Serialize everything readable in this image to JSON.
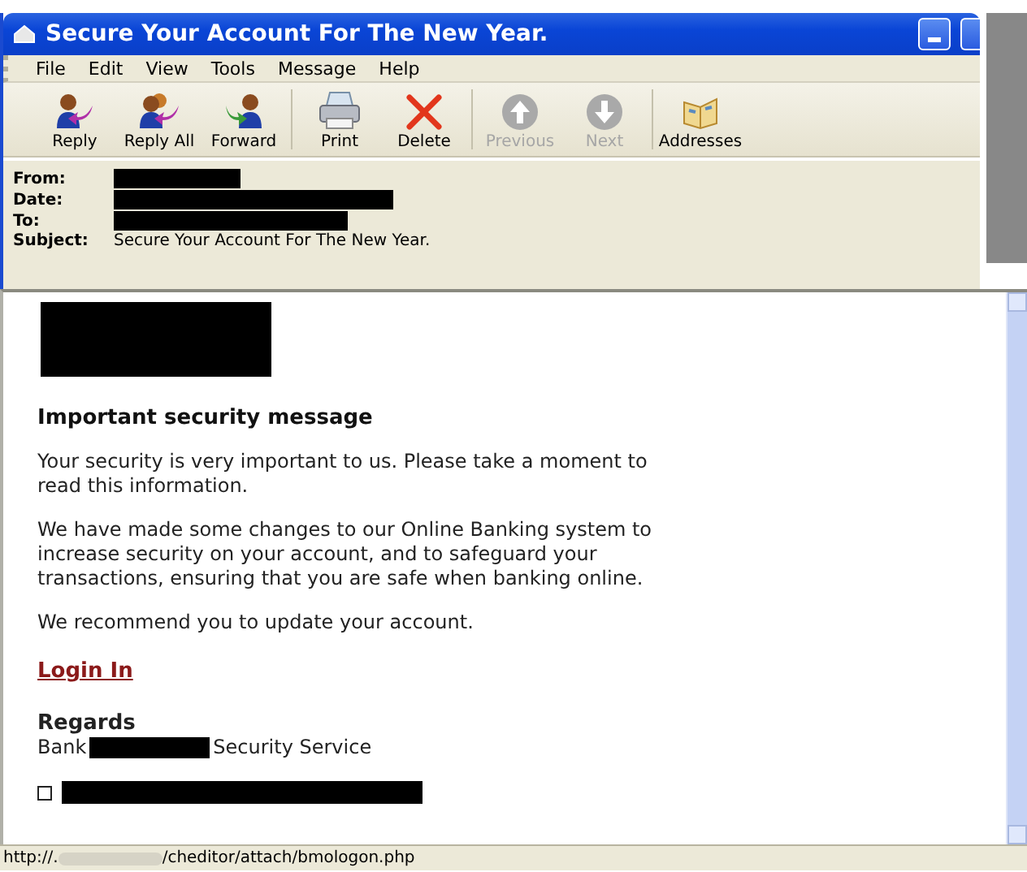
{
  "window": {
    "title": "Secure Your Account For The New Year."
  },
  "menu": [
    "File",
    "Edit",
    "View",
    "Tools",
    "Message",
    "Help"
  ],
  "toolbar": [
    {
      "kind": "reply",
      "label": "Reply",
      "disabled": false
    },
    {
      "kind": "reply_all",
      "label": "Reply All",
      "disabled": false
    },
    {
      "kind": "forward",
      "label": "Forward",
      "disabled": false
    },
    {
      "kind": "print",
      "label": "Print",
      "disabled": false
    },
    {
      "kind": "delete",
      "label": "Delete",
      "disabled": false
    },
    {
      "kind": "previous",
      "label": "Previous",
      "disabled": true
    },
    {
      "kind": "next",
      "label": "Next",
      "disabled": true
    },
    {
      "kind": "addresses",
      "label": "Addresses",
      "disabled": false
    }
  ],
  "header": [
    {
      "label": "From:",
      "redacted": true
    },
    {
      "label": "Date:",
      "redacted": true
    },
    {
      "label": "To:",
      "redacted": true
    },
    {
      "label": "Subject:",
      "redacted": false,
      "value": "Secure Your Account For The New Year."
    }
  ],
  "message": {
    "logo_redacted": true,
    "heading": "Important security message",
    "paragraphs": [
      "Your security is very important to us. Please take a moment to read this information.",
      "We have made some changes to our Online Banking system to increase security on your account, and to safeguard your transactions, ensuring that you are safe when banking online.",
      "We recommend you to update your account."
    ],
    "link": "Login In",
    "closing": "Regards",
    "signature_before": "Bank",
    "signature_after": "Security Service",
    "footer_redacted": true
  },
  "status_bar": {
    "url_start": "http://.",
    "url_end": "/cheditor/attach/bmologon.php"
  }
}
